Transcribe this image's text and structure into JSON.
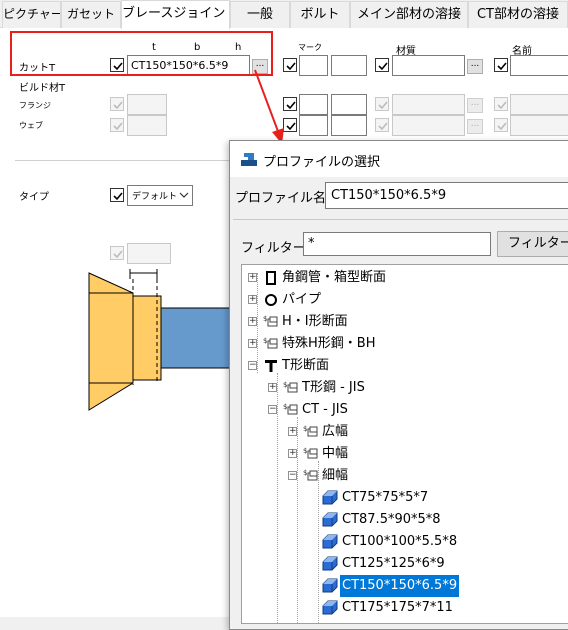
{
  "tabs": [
    "ピクチャー",
    "ガセット",
    "ブレースジョイント",
    "一般",
    "ボルト",
    "メイン部材の溶接",
    "CT部材の溶接"
  ],
  "active_tab": "ブレースジョイント",
  "main": {
    "col_t": "t",
    "col_b": "b",
    "col_h": "h",
    "col_mark": "マーク",
    "col_material": "材質",
    "col_name": "名前",
    "row_cut_t": "カットT",
    "row_built": "ビルド材T",
    "row_flange": "フランジ",
    "row_web": "ウェブ",
    "cut_t_value": "CT150*150*6.5*9",
    "browse": "...",
    "type_label": "タイプ",
    "type_value": "デフォルト"
  },
  "colors": {
    "highlight": "#e8201c",
    "selection": "#0078d7",
    "brace": "#6699cc",
    "gusset": "#ffcc66"
  },
  "dialog": {
    "title": "プロファイルの選択",
    "profile_label": "プロファイル名:",
    "profile_value": "CT150*150*6.5*9",
    "filter_label": "フィルター:",
    "filter_value": "*",
    "filter_button": "フィルター(F",
    "tree": [
      {
        "label": "角鋼管・箱型断面",
        "icon": "box-section-icon"
      },
      {
        "label": "パイプ",
        "icon": "pipe-icon"
      },
      {
        "label": "H・I形断面",
        "icon": "shape-group-icon"
      },
      {
        "label": "特殊H形鋼・BH",
        "icon": "shape-group-icon"
      },
      {
        "label": "T形断面",
        "icon": "t-section-icon"
      },
      {
        "label": "T形鋼 - JIS",
        "icon": "shape-group-icon"
      },
      {
        "label": "CT - JIS",
        "icon": "shape-group-icon"
      },
      {
        "label": "広幅",
        "icon": "shape-group-icon"
      },
      {
        "label": "中幅",
        "icon": "shape-group-icon"
      },
      {
        "label": "細幅",
        "icon": "shape-group-icon"
      },
      {
        "label": "CT75*75*5*7",
        "icon": "profile-item-icon"
      },
      {
        "label": "CT87.5*90*5*8",
        "icon": "profile-item-icon"
      },
      {
        "label": "CT100*100*5.5*8",
        "icon": "profile-item-icon"
      },
      {
        "label": "CT125*125*6*9",
        "icon": "profile-item-icon"
      },
      {
        "label": "CT150*150*6.5*9",
        "icon": "profile-item-icon"
      },
      {
        "label": "CT175*175*7*11",
        "icon": "profile-item-icon"
      }
    ]
  }
}
